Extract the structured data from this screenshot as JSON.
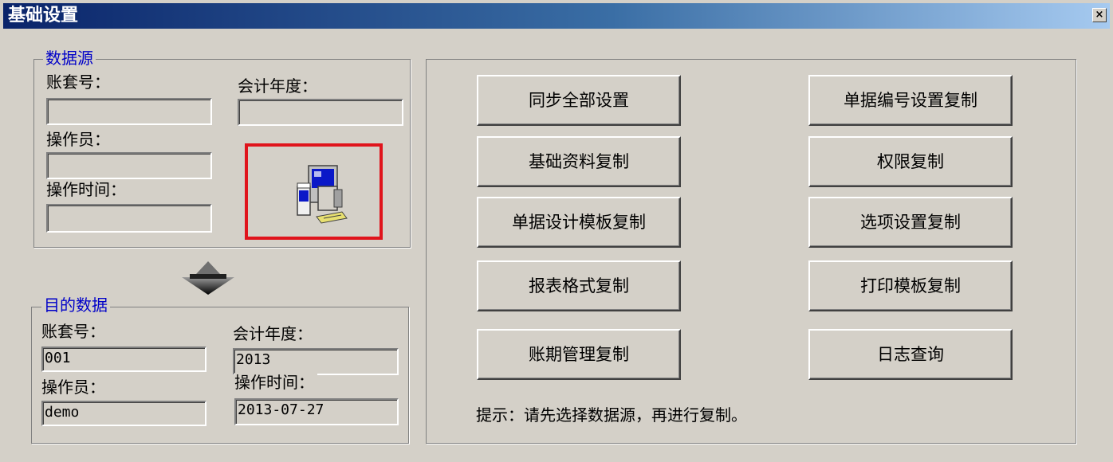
{
  "window": {
    "title": "基础设置",
    "close_symbol": "×"
  },
  "source": {
    "legend": "数据源",
    "account_label": "账套号：",
    "year_label": "会计年度：",
    "operator_label": "操作员：",
    "time_label": "操作时间：",
    "account_value": "",
    "year_value": "",
    "operator_value": "",
    "time_value": ""
  },
  "target": {
    "legend": "目的数据",
    "account_label": "账套号：",
    "year_label": "会计年度：",
    "operator_label": "操作员：",
    "time_label": "操作时间：",
    "account_value": "001",
    "year_value": "2013",
    "operator_value": "demo",
    "time_value": "2013-07-27"
  },
  "buttons": {
    "sync_all": "同步全部设置",
    "doc_number_copy": "单据编号设置复制",
    "basic_data_copy": "基础资料复制",
    "permission_copy": "权限复制",
    "doc_template_copy": "单据设计模板复制",
    "option_copy": "选项设置复制",
    "report_format_copy": "报表格式复制",
    "print_template_copy": "打印模板复制",
    "period_copy": "账期管理复制",
    "log_query": "日志查询"
  },
  "tip": "提示：请先选择数据源，再进行复制。",
  "icons": {
    "source_select": "computer-icon",
    "direction": "arrow-down-icon"
  }
}
